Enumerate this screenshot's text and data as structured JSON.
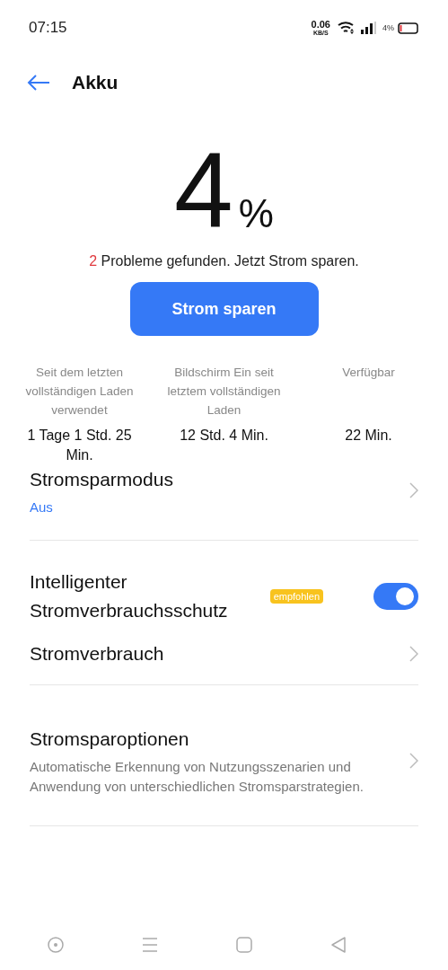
{
  "status_bar": {
    "time": "07:15",
    "speed_value": "0.06",
    "speed_unit": "KB/S",
    "battery_text": "4%"
  },
  "header": {
    "title": "Akku"
  },
  "battery": {
    "percent": "4",
    "unit": "%"
  },
  "problems": {
    "count": "2",
    "text": "Probleme gefunden. Jetzt Strom sparen."
  },
  "save_button": {
    "label": "Strom sparen"
  },
  "stats": [
    {
      "label": "Seit dem letzten vollständigen Laden verwendet",
      "value": "1 Tage 1 Std. 25 Min."
    },
    {
      "label": "Bildschirm Ein seit letztem vollständigen Laden",
      "value": "12 Std. 4 Min."
    },
    {
      "label": "Verfügbar",
      "value": "22 Min."
    }
  ],
  "groups": [
    {
      "items": [
        {
          "kind": "nav",
          "title": "Stromsparmodus",
          "value": "Aus"
        }
      ]
    },
    {
      "items": [
        {
          "kind": "toggle",
          "title": "Intelligenter Stromverbrauchsschutz",
          "badge": "empfohlen",
          "on": true
        },
        {
          "kind": "nav",
          "title": "Stromverbrauch"
        }
      ]
    },
    {
      "items": [
        {
          "kind": "nav",
          "title": "Stromsparoptionen",
          "description": "Automatische Erkennung von Nutzungsszenarien und Anwendung von unterschiedlichen Stromsparstrategien."
        }
      ]
    }
  ]
}
